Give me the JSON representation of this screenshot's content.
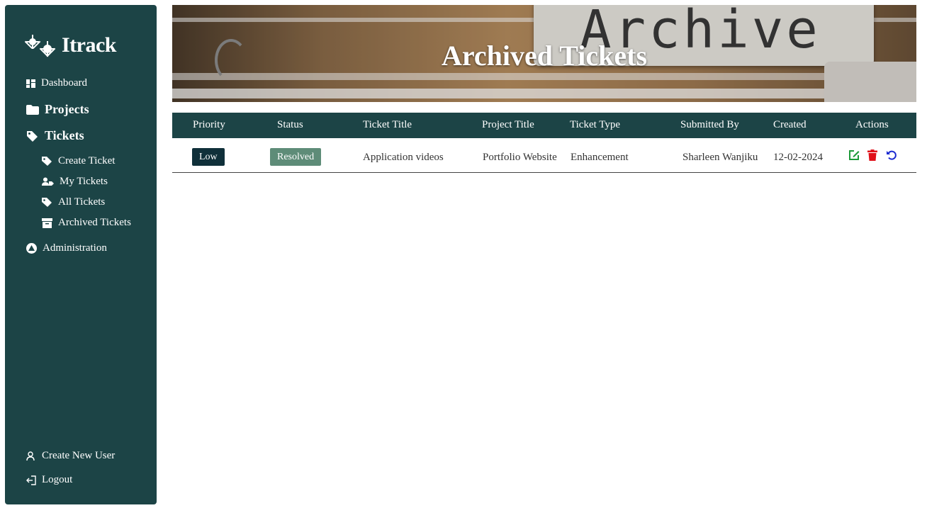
{
  "app": {
    "brand": "Itrack"
  },
  "sidebar": {
    "items": [
      {
        "label": "Dashboard",
        "icon": "dashboard-icon"
      },
      {
        "label": "Projects",
        "icon": "folder-icon"
      },
      {
        "label": "Tickets",
        "icon": "tags-icon"
      },
      {
        "label": "Create Ticket",
        "icon": "tag-icon"
      },
      {
        "label": "My Tickets",
        "icon": "user-tag-icon"
      },
      {
        "label": "All Tickets",
        "icon": "tag-icon"
      },
      {
        "label": "Archived Tickets",
        "icon": "archive-icon"
      },
      {
        "label": "Administration",
        "icon": "triangle-circle-icon"
      }
    ],
    "footer": [
      {
        "label": "Create New User",
        "icon": "user-icon"
      },
      {
        "label": "Logout",
        "icon": "logout-icon"
      }
    ]
  },
  "banner": {
    "title": "Archived Tickets",
    "image_text": "Archive"
  },
  "table": {
    "columns": [
      "Priority",
      "Status",
      "Ticket Title",
      "Project Title",
      "Ticket Type",
      "Submitted By",
      "Created",
      "Actions"
    ],
    "rows": [
      {
        "priority": "Low",
        "status": "Resolved",
        "ticket_title": "Application videos",
        "project_title": "Portfolio Website",
        "ticket_type": "Enhancement",
        "submitted_by": "Sharleen Wanjiku",
        "created": "12-02-2024",
        "actions": [
          "edit-icon",
          "trash-icon",
          "restore-icon"
        ]
      }
    ]
  },
  "colors": {
    "sidebar_bg": "#1c4446",
    "header_bg": "#1c4446",
    "low_badge": "#10303a",
    "resolved_badge": "#5e8c78",
    "edit": "#1e9a3a",
    "delete": "#e0101a",
    "restore": "#1a2ad0"
  }
}
